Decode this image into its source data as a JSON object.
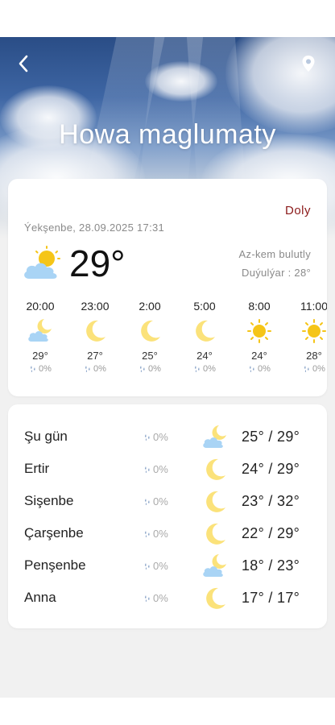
{
  "header": {
    "title": "Howa maglumaty",
    "back_icon": "chevron-left-icon",
    "location_icon": "location-pin-icon"
  },
  "current": {
    "details_link": "Doly",
    "date": "Ýekşenbe, 28.09.2025",
    "time": "17:31",
    "temperature": "29°",
    "condition": "Az-kem bulutly",
    "feels_like": "Duýulýar : 28°",
    "icon": "partly-cloudy-day-icon"
  },
  "hourly": [
    {
      "time": "20:00",
      "icon": "partly-cloudy-night-icon",
      "temp": "29°",
      "precip": "0%"
    },
    {
      "time": "23:00",
      "icon": "moon-icon",
      "temp": "27°",
      "precip": "0%"
    },
    {
      "time": "2:00",
      "icon": "moon-icon",
      "temp": "25°",
      "precip": "0%"
    },
    {
      "time": "5:00",
      "icon": "moon-icon",
      "temp": "24°",
      "precip": "0%"
    },
    {
      "time": "8:00",
      "icon": "sun-icon",
      "temp": "24°",
      "precip": "0%"
    },
    {
      "time": "11:00",
      "icon": "sun-icon",
      "temp": "28°",
      "precip": "0%"
    }
  ],
  "daily": [
    {
      "day": "Şu gün",
      "precip": "0%",
      "icon": "partly-cloudy-night-icon",
      "temps": "25° / 29°"
    },
    {
      "day": "Ertir",
      "precip": "0%",
      "icon": "moon-icon",
      "temps": "24° / 29°"
    },
    {
      "day": "Sişenbe",
      "precip": "0%",
      "icon": "moon-icon",
      "temps": "23° / 32°"
    },
    {
      "day": "Çarşenbe",
      "precip": "0%",
      "icon": "moon-icon",
      "temps": "22° / 29°"
    },
    {
      "day": "Penşenbe",
      "precip": "0%",
      "icon": "partly-cloudy-night-icon",
      "temps": "18° / 23°"
    },
    {
      "day": "Anna",
      "precip": "0%",
      "icon": "moon-icon",
      "temps": "17° / 17°"
    }
  ],
  "colors": {
    "accent": "#8b1a1a",
    "sun": "#f5c518",
    "moon": "#fbe27a",
    "cloud": "#a9d4f5",
    "muted_text": "#8a8a8a"
  }
}
